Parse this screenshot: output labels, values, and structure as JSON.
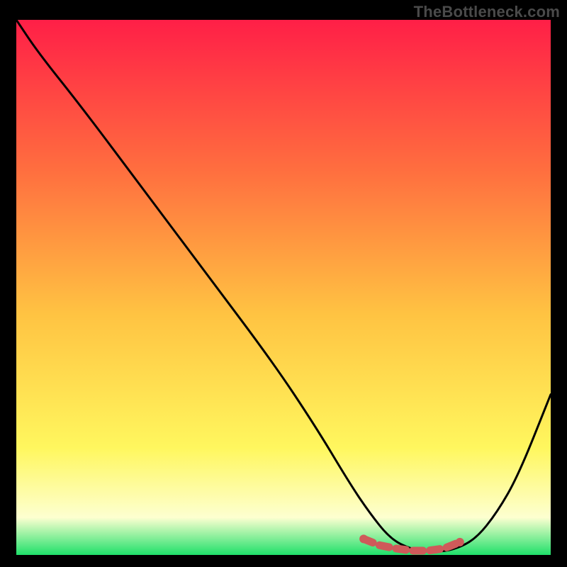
{
  "watermark": "TheBottleneck.com",
  "colors": {
    "gradient_top": "#ff1f47",
    "gradient_mid_upper": "#ff6e3f",
    "gradient_mid": "#ffc342",
    "gradient_mid_lower": "#fff75e",
    "gradient_low": "#fdffd0",
    "gradient_bottom": "#1fe06a",
    "curve": "#000000",
    "marker": "#cf5a5a",
    "background": "#000000"
  },
  "chart_data": {
    "type": "line",
    "title": "",
    "xlabel": "",
    "ylabel": "",
    "xlim": [
      0,
      100
    ],
    "ylim": [
      0,
      100
    ],
    "grid": false,
    "legend": false,
    "series": [
      {
        "name": "bottleneck-curve",
        "x": [
          0,
          4,
          12,
          24,
          36,
          48,
          56,
          62,
          66,
          70,
          74,
          78,
          82,
          86,
          90,
          94,
          100
        ],
        "y": [
          100,
          94,
          84,
          68,
          52,
          36,
          24,
          14,
          8,
          3,
          1,
          0.5,
          1,
          3,
          8,
          15,
          30
        ]
      }
    ],
    "markers": [
      {
        "name": "optimal-range",
        "x": [
          65,
          68,
          71,
          74,
          77,
          80,
          83
        ],
        "y": [
          3.0,
          1.8,
          1.2,
          0.8,
          0.8,
          1.2,
          2.4
        ]
      }
    ]
  }
}
